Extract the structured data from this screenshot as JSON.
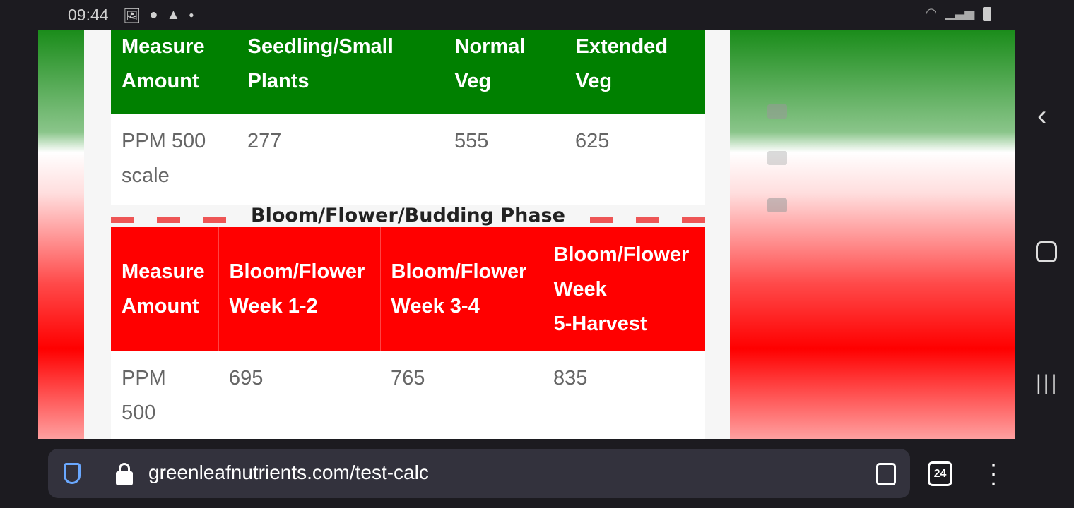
{
  "status": {
    "time": "09:44",
    "icons": [
      "image-icon",
      "account-icon",
      "warning-icon",
      "dot-icon"
    ],
    "right_icons": [
      "wifi-icon",
      "signal-icon",
      "battery-icon"
    ]
  },
  "veg_table": {
    "headers": [
      [
        "Measure",
        "Amount"
      ],
      [
        "Seedling/Small",
        "Plants"
      ],
      [
        "Normal",
        "Veg"
      ],
      [
        "Extended",
        "Veg"
      ]
    ],
    "row": [
      "PPM 500 scale",
      "277",
      "555",
      "625"
    ],
    "color": "#008000"
  },
  "bloom_phase": {
    "title": "Bloom/Flower/Budding Phase",
    "dash_color": "#ee5555"
  },
  "bloom_table": {
    "headers": [
      [
        "Measure",
        "Amount"
      ],
      [
        "Bloom/Flower",
        "Week 1-2"
      ],
      [
        "Bloom/Flower",
        "Week 3-4"
      ],
      [
        "Bloom/Flower",
        "Week",
        "5-Harvest"
      ]
    ],
    "row": [
      "PPM 500",
      "695",
      "765",
      "835"
    ],
    "color": "#ff0000"
  },
  "browser": {
    "url": "greenleafnutrients.com/test-calc",
    "tab_count": "24"
  }
}
